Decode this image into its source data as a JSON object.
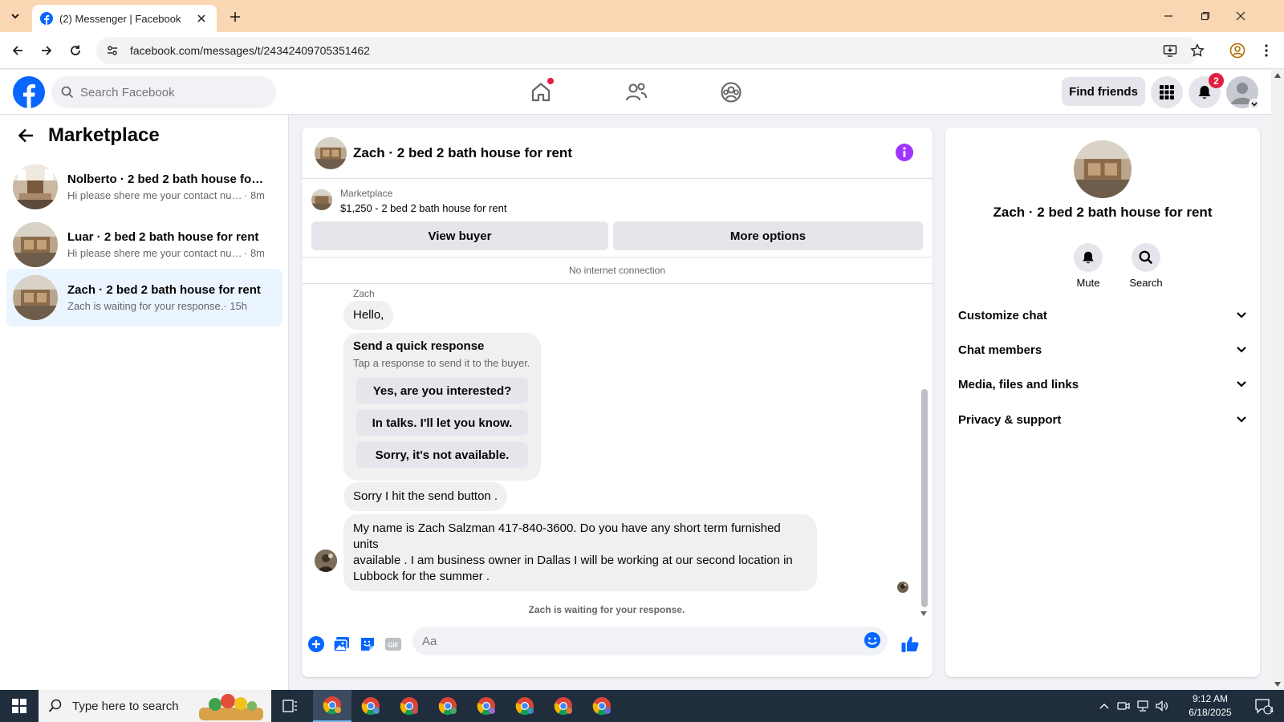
{
  "browser": {
    "tab_title": "(2) Messenger | Facebook",
    "url": "facebook.com/messages/t/24342409705351462"
  },
  "fb": {
    "search_placeholder": "Search Facebook",
    "find_friends": "Find friends",
    "notifications_count": "2"
  },
  "sidebar": {
    "title": "Marketplace",
    "conversations": [
      {
        "name": "Nolberto · 2 bed 2 bath house for ...",
        "snippet": "Hi please shere me your contact num...",
        "time": " · 8m"
      },
      {
        "name": "Luar · 2 bed 2 bath house for rent",
        "snippet": "Hi please shere me your contact num...",
        "time": " · 8m"
      },
      {
        "name": "Zach · 2 bed 2 bath house for rent",
        "snippet": "Zach is waiting for your response.",
        "time": " · 15h"
      }
    ]
  },
  "chat": {
    "title": "Zach · 2 bed 2 bath house for rent",
    "marketplace_label": "Marketplace",
    "listing": "$1,250 - 2 bed 2 bath house for rent",
    "view_buyer": "View buyer",
    "more_options": "More options",
    "no_connection": "No internet connection",
    "sender": "Zach",
    "messages": {
      "hello": "Hello,",
      "sorry": "Sorry I hit the send button .",
      "long_line1": "My name is Zach Salzman 417-840-3600. Do you have any short term furnished units",
      "long_line2": "available . I am  business owner in Dallas I will be working at our second location in",
      "long_line3": "Lubbock for the summer ."
    },
    "quick_response": {
      "title": "Send a quick response",
      "subtitle": "Tap a response to send it to the buyer.",
      "options": [
        "Yes, are you interested?",
        "In talks. I'll let you know.",
        "Sorry, it's not available."
      ]
    },
    "waiting": "Zach is waiting for your response.",
    "composer_placeholder": "Aa"
  },
  "details": {
    "name": "Zach · 2 bed 2 bath house for rent",
    "mute": "Mute",
    "search": "Search",
    "sections": [
      "Customize chat",
      "Chat members",
      "Media, files and links",
      "Privacy & support"
    ]
  },
  "taskbar": {
    "search_placeholder": "Type here to search",
    "time": "9:12 AM",
    "date": "6/18/2025",
    "notif_count": "4"
  },
  "colors": {
    "fb_blue": "#0866ff",
    "messenger_purple": "#a033ff",
    "active_conv": "#ebf5ff"
  }
}
